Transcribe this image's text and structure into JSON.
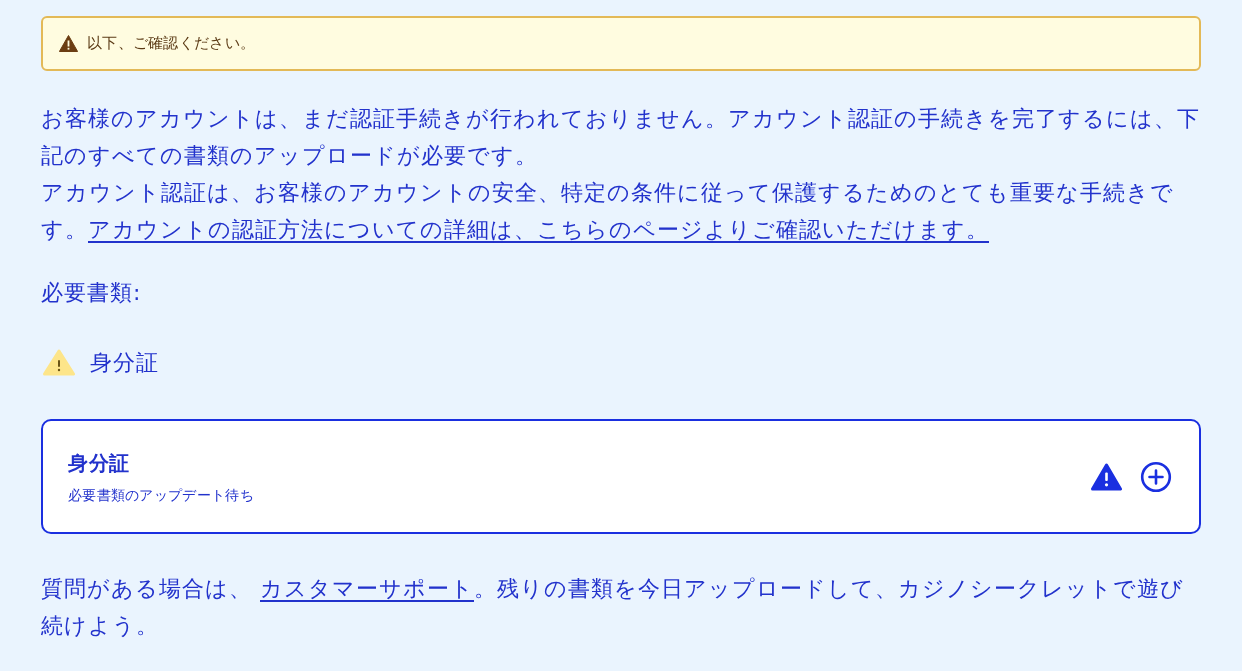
{
  "alert": {
    "kind": "warning",
    "text": "以下、ご確認ください。"
  },
  "intro": {
    "text": "お客様のアカウントは、まだ認証手続きが行われておりません。アカウント認証の手続きを完了するには、下記のすべての書類のアップロードが必要です。",
    "text_2": "アカウント認証は、お客様のアカウントの安全、特定の条件に従って保護するためのとても重要な手続きです。",
    "link": "アカウントの認証方法についての詳細は、こちらのページよりご確認いただけます。"
  },
  "required_label": "必要書類:",
  "required_documents": [
    {
      "label": "身分証",
      "kind": "warning"
    }
  ],
  "document_cards": [
    {
      "title": "身分証",
      "subtitle": "必要書類のアップデート待ち",
      "kind": "warning"
    }
  ],
  "footer": {
    "text_before": "質問がある場合は、",
    "link": "カスタマーサポート",
    "text_after": "。残りの書類を今日アップロードして、カジノシークレットで遊び続けよう。"
  }
}
